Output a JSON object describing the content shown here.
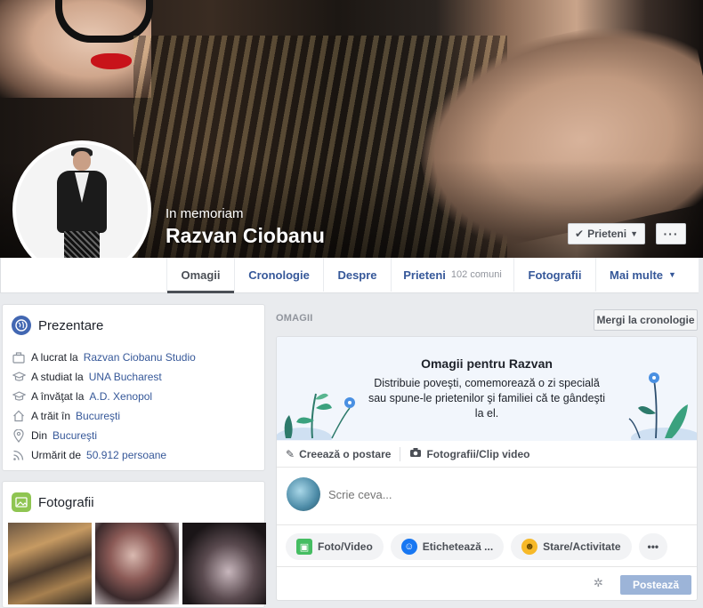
{
  "cover": {
    "subtitle": "In memoriam",
    "name": "Razvan Ciobanu",
    "friends_button": "Prieteni",
    "more_button": "···"
  },
  "nav": {
    "tabs": [
      {
        "label": "Omagii",
        "active": true
      },
      {
        "label": "Cronologie"
      },
      {
        "label": "Despre"
      },
      {
        "label": "Prieteni",
        "count": "102 comuni"
      },
      {
        "label": "Fotografii"
      },
      {
        "label": "Mai multe"
      }
    ]
  },
  "intro": {
    "title": "Prezentare",
    "items": [
      {
        "icon": "briefcase-icon",
        "prefix": "A lucrat la ",
        "link": "Razvan Ciobanu Studio"
      },
      {
        "icon": "graduation-cap-icon",
        "prefix": "A studiat la ",
        "link": "UNA Bucharest"
      },
      {
        "icon": "graduation-cap-icon",
        "prefix": "A învăţat la ",
        "link": "A.D. Xenopol"
      },
      {
        "icon": "home-icon",
        "prefix": "A trăit în ",
        "link": "Bucureşti"
      },
      {
        "icon": "location-pin-icon",
        "prefix": "Din ",
        "link": "Bucureşti"
      },
      {
        "icon": "followers-icon",
        "prefix": "Urmărit de ",
        "link": "50.912 persoane"
      }
    ]
  },
  "photos": {
    "title": "Fotografii"
  },
  "tributes": {
    "section_label": "OMAGII",
    "timeline_button": "Mergi la cronologie",
    "banner_title": "Omagii pentru Razvan",
    "banner_text": "Distribuie poveşti, comemorează o zi specială sau spune-le prietenilor şi familiei că te gândeşti la el.",
    "tab_create": "Creează o postare",
    "tab_media": "Fotografii/Clip video",
    "write_placeholder": "Scrie ceva...",
    "actions": [
      "Foto/Video",
      "Etichetează ...",
      "Stare/Activitate"
    ],
    "more_actions": "•••",
    "post_button": "Postează"
  },
  "colors": {
    "link": "#365899",
    "background": "#e9ebee",
    "post_button": "#9cb4d8"
  }
}
